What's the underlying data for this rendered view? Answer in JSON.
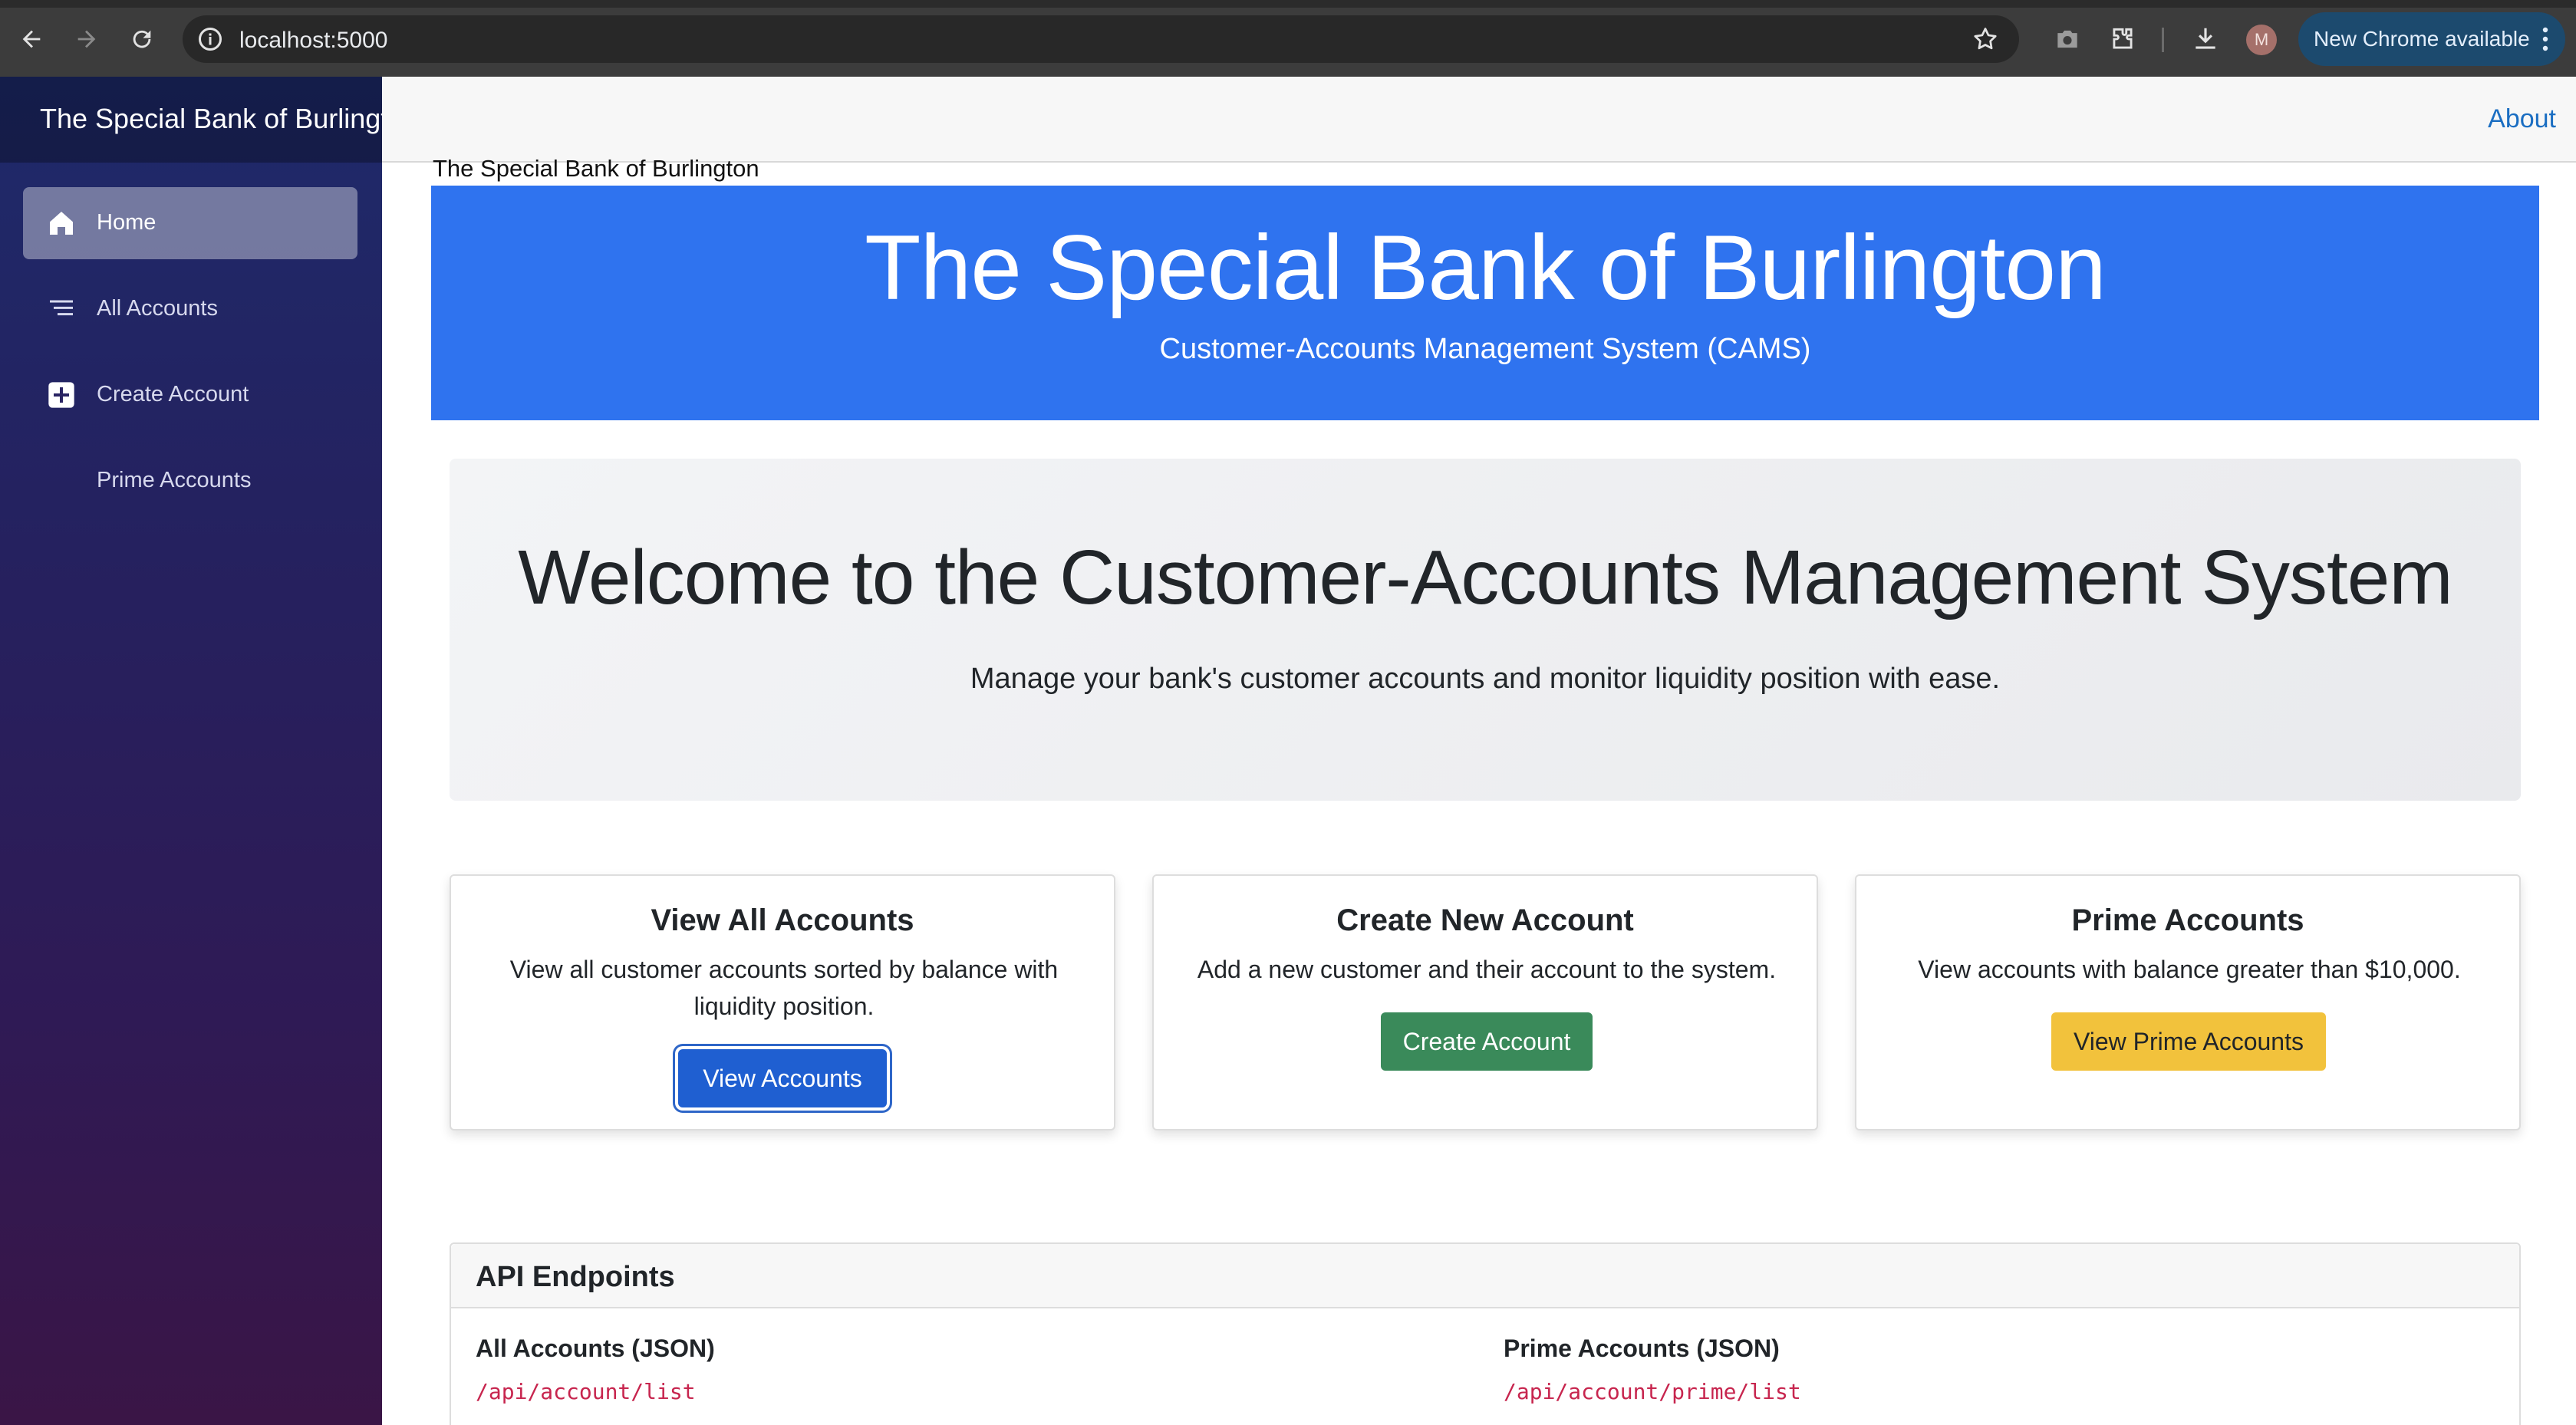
{
  "browser": {
    "url": "localhost:5000",
    "new_chrome_label": "New Chrome available",
    "profile_initial": "M"
  },
  "sidebar": {
    "brand": "The Special Bank of Burlington",
    "items": [
      {
        "label": "Home",
        "icon": "home-icon",
        "active": true
      },
      {
        "label": "All Accounts",
        "icon": "list-icon",
        "active": false
      },
      {
        "label": "Create Account",
        "icon": "plus-box-icon",
        "active": false
      },
      {
        "label": "Prime Accounts",
        "icon": "",
        "active": false
      }
    ]
  },
  "topbar": {
    "about_label": "About"
  },
  "page": {
    "caption": "The Special Bank of Burlington"
  },
  "banner": {
    "title": "The Special Bank of Burlington",
    "subtitle": "Customer-Accounts Management System (CAMS)"
  },
  "welcome": {
    "heading": "Welcome to the Customer-Accounts Management System",
    "lead": "Manage your bank's customer accounts and monitor liquidity position with ease."
  },
  "cards": [
    {
      "title": "View All Accounts",
      "text": "View all customer accounts sorted by balance with liquidity position.",
      "button": "View Accounts"
    },
    {
      "title": "Create New Account",
      "text": "Add a new customer and their account to the system.",
      "button": "Create Account"
    },
    {
      "title": "Prime Accounts",
      "text": "View accounts with balance greater than $10,000.",
      "button": "View Prime Accounts"
    }
  ],
  "api": {
    "heading": "API Endpoints",
    "endpoints": [
      {
        "title": "All Accounts (JSON)",
        "path": "/api/account/list"
      },
      {
        "title": "Prime Accounts (JSON)",
        "path": "/api/account/prime/list"
      }
    ]
  },
  "colors": {
    "banner": "#2f73ef",
    "primary_button": "#1f5fd1",
    "success_button": "#3a8a5a",
    "warning_button": "#f2c23c",
    "link": "#1b6ec2",
    "code": "#c7254e"
  }
}
